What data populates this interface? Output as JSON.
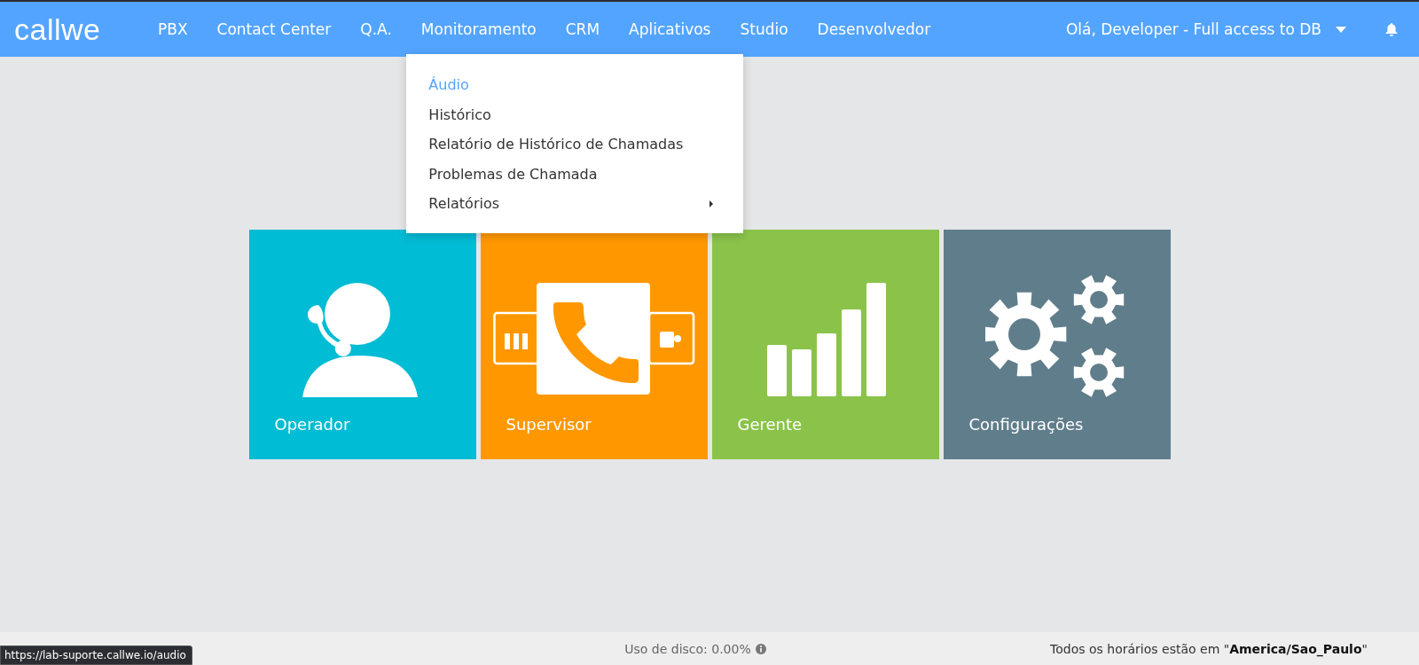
{
  "header": {
    "logo": "callwe",
    "nav": [
      {
        "label": "PBX",
        "expanded": false
      },
      {
        "label": "Contact Center",
        "expanded": false
      },
      {
        "label": "Q.A.",
        "expanded": false
      },
      {
        "label": "Monitoramento",
        "expanded": true
      },
      {
        "label": "CRM",
        "expanded": false
      },
      {
        "label": "Aplicativos",
        "expanded": false
      },
      {
        "label": "Studio",
        "expanded": false
      },
      {
        "label": "Desenvolvedor",
        "expanded": false
      }
    ],
    "user": "Olá, Developer - Full access to DB"
  },
  "dropdown": {
    "items": [
      {
        "label": "Áudio",
        "selected": true,
        "submenu": false
      },
      {
        "label": "Histórico",
        "selected": false,
        "submenu": false
      },
      {
        "label": "Relatório de Histórico de Chamadas",
        "selected": false,
        "submenu": false
      },
      {
        "label": "Problemas de Chamada",
        "selected": false,
        "submenu": false
      },
      {
        "label": "Relatórios",
        "selected": false,
        "submenu": true
      }
    ]
  },
  "tiles": [
    {
      "label": "Operador",
      "kind": "headset",
      "color": "#00bcd4"
    },
    {
      "label": "Supervisor",
      "kind": "phone",
      "color": "#ff9800"
    },
    {
      "label": "Gerente",
      "kind": "bars",
      "color": "#8bc34a"
    },
    {
      "label": "Configurações",
      "kind": "gears",
      "color": "#607d8b"
    }
  ],
  "footer": {
    "disk": "Uso de disco: 0.00%",
    "timezone": "Todos os horários estão em \"**America/Sao_Paulo**\""
  },
  "link_tooltip": "https://lab-suporte.callwe.io/audio"
}
